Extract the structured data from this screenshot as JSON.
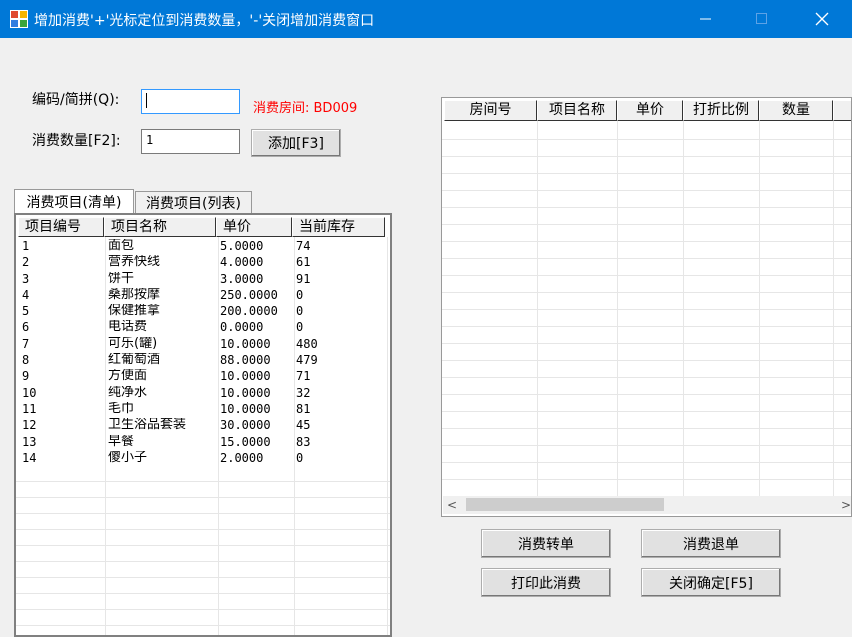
{
  "window": {
    "title": "增加消费'+'光标定位到消费数量，'-'关闭增加消费窗口",
    "min_glyph": "—",
    "max_glyph": "☐",
    "close_glyph": "✕"
  },
  "form": {
    "code_label": "编码/简拼(Q):",
    "code_value": "",
    "room_info": "消费房间: BD009",
    "qty_label": "消费数量[F2]:",
    "qty_value": "1",
    "add_button": "添加[F3]"
  },
  "tabs": [
    {
      "label": "消费项目(清单)",
      "active": true
    },
    {
      "label": "消费项目(列表)",
      "active": false
    }
  ],
  "item_list": {
    "columns": [
      "项目编号",
      "项目名称",
      "单价",
      "当前库存"
    ],
    "rows": [
      [
        "1",
        "面包",
        "5.0000",
        "74"
      ],
      [
        "2",
        "营养快线",
        "4.0000",
        "61"
      ],
      [
        "3",
        "饼干",
        "3.0000",
        "91"
      ],
      [
        "4",
        "桑那按摩",
        "250.0000",
        "0"
      ],
      [
        "5",
        "保健推拿",
        "200.0000",
        "0"
      ],
      [
        "6",
        "电话费",
        "0.0000",
        "0"
      ],
      [
        "7",
        "可乐(罐)",
        "10.0000",
        "480"
      ],
      [
        "8",
        "红葡萄酒",
        "88.0000",
        "479"
      ],
      [
        "9",
        "方便面",
        "10.0000",
        "71"
      ],
      [
        "10",
        "纯净水",
        "10.0000",
        "32"
      ],
      [
        "11",
        "毛巾",
        "10.0000",
        "81"
      ],
      [
        "12",
        "卫生浴品套装",
        "30.0000",
        "45"
      ],
      [
        "13",
        "早餐",
        "15.0000",
        "83"
      ],
      [
        "14",
        "傻小子",
        "2.0000",
        "0"
      ]
    ]
  },
  "consume_grid": {
    "columns": [
      "房间号",
      "项目名称",
      "单价",
      "打折比例",
      "数量",
      ""
    ],
    "scroll_left": "<",
    "scroll_right": ">"
  },
  "buttons": {
    "transfer": "消费转单",
    "refund": "消费退单",
    "print": "打印此消费",
    "close_confirm": "关闭确定[F5]"
  },
  "colors": {
    "titlebar": "#0078d7",
    "room_text": "#ff0000"
  }
}
